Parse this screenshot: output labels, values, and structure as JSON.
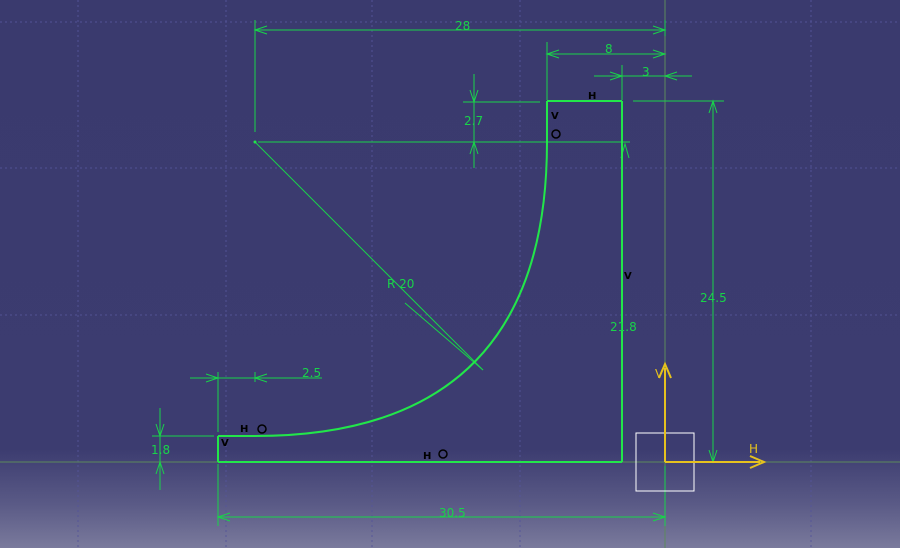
{
  "dimensions": {
    "width_28": "28",
    "width_8": "8",
    "width_3": "3",
    "height_2_7": "2.7",
    "radius": "R 20",
    "height_24_5": "24.5",
    "height_21_8": "21.8",
    "width_2_5": "2.5",
    "height_1_8": "1.8",
    "width_30_5": "30.5"
  },
  "constraints": {
    "vertical": "V",
    "horizontal": "H"
  },
  "axes": {
    "h_label": "H",
    "v_label": "V"
  },
  "colors": {
    "background": "#3a3a6e",
    "grid": "#5a5aa0",
    "geometry": "#22e64a",
    "dimension": "#19d34a",
    "axis": "#e6c21e"
  }
}
